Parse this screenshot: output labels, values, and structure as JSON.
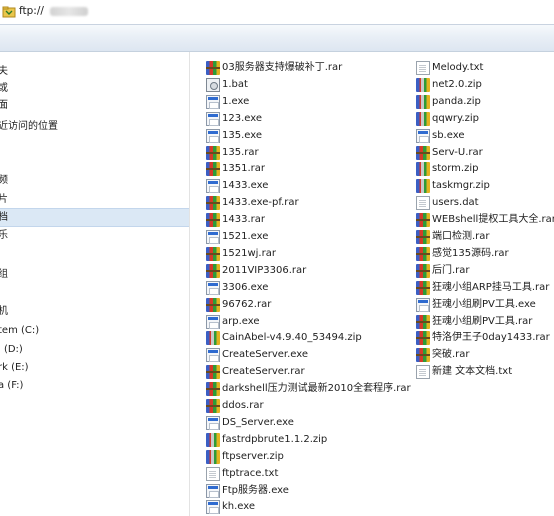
{
  "address": {
    "text": "ftp://"
  },
  "nav": {
    "items": [
      {
        "label": "夫"
      },
      {
        "label": "或"
      },
      {
        "label": "面"
      },
      {
        "label": "近访问的位置"
      },
      {
        "label": ""
      },
      {
        "label": ""
      },
      {
        "label": ""
      },
      {
        "label": "频"
      },
      {
        "label": "片"
      },
      {
        "label": "档"
      },
      {
        "label": "乐"
      },
      {
        "label": ""
      },
      {
        "label": ""
      },
      {
        "label": "组"
      },
      {
        "label": ""
      },
      {
        "label": ""
      },
      {
        "label": "机"
      },
      {
        "label": "tem (C:)"
      },
      {
        "label": "l (D:)"
      },
      {
        "label": "rk (E:)"
      },
      {
        "label": "a (F:)"
      }
    ]
  },
  "files": {
    "col1": [
      {
        "name": "03服务器支持爆破补丁.rar",
        "icon": "rar-icon"
      },
      {
        "name": "1.bat",
        "icon": "bat-icon"
      },
      {
        "name": "1.exe",
        "icon": "exe-icon"
      },
      {
        "name": "123.exe",
        "icon": "exe-icon"
      },
      {
        "name": "135.exe",
        "icon": "exe-icon"
      },
      {
        "name": "135.rar",
        "icon": "rar-icon"
      },
      {
        "name": "1351.rar",
        "icon": "rar-icon"
      },
      {
        "name": "1433.exe",
        "icon": "exe-icon"
      },
      {
        "name": "1433.exe-pf.rar",
        "icon": "rar-icon"
      },
      {
        "name": "1433.rar",
        "icon": "rar-icon"
      },
      {
        "name": "1521.exe",
        "icon": "exe-icon"
      },
      {
        "name": "1521wj.rar",
        "icon": "rar-icon"
      },
      {
        "name": "2011VIP3306.rar",
        "icon": "rar-icon"
      },
      {
        "name": "3306.exe",
        "icon": "exe-icon"
      },
      {
        "name": "96762.rar",
        "icon": "rar-icon"
      },
      {
        "name": "arp.exe",
        "icon": "exe-icon"
      },
      {
        "name": "CainAbel-v4.9.40_53494.zip",
        "icon": "zip-icon"
      },
      {
        "name": "CreateServer.exe",
        "icon": "exe-icon"
      },
      {
        "name": "CreateServer.rar",
        "icon": "rar-icon"
      },
      {
        "name": "darkshell压力测试最新2010全套程序.rar",
        "icon": "rar-icon"
      },
      {
        "name": "ddos.rar",
        "icon": "rar-icon"
      },
      {
        "name": "DS_Server.exe",
        "icon": "exe-icon"
      },
      {
        "name": "fastrdpbrute1.1.2.zip",
        "icon": "zip-icon"
      },
      {
        "name": "ftpserver.zip",
        "icon": "zip-icon"
      },
      {
        "name": "ftptrace.txt",
        "icon": "txt-icon"
      },
      {
        "name": "Ftp服务器.exe",
        "icon": "exe-icon"
      },
      {
        "name": "kh.exe",
        "icon": "exe-icon"
      }
    ],
    "col2": [
      {
        "name": "Melody.txt",
        "icon": "txt-icon"
      },
      {
        "name": "net2.0.zip",
        "icon": "zip-icon"
      },
      {
        "name": "panda.zip",
        "icon": "zip-icon"
      },
      {
        "name": "qqwry.zip",
        "icon": "zip-icon"
      },
      {
        "name": "sb.exe",
        "icon": "exe-icon"
      },
      {
        "name": "Serv-U.rar",
        "icon": "rar-icon"
      },
      {
        "name": "storm.zip",
        "icon": "zip-icon"
      },
      {
        "name": "taskmgr.zip",
        "icon": "zip-icon"
      },
      {
        "name": "users.dat",
        "icon": "txt-icon"
      },
      {
        "name": "WEBshell提权工具大全.rar",
        "icon": "rar-icon"
      },
      {
        "name": "端口检测.rar",
        "icon": "rar-icon"
      },
      {
        "name": "感觉135源码.rar",
        "icon": "rar-icon"
      },
      {
        "name": "后门.rar",
        "icon": "rar-icon"
      },
      {
        "name": "狂魂小组ARP挂马工具.rar",
        "icon": "rar-icon"
      },
      {
        "name": "狂魂小组刷PV工具.exe",
        "icon": "exe-icon"
      },
      {
        "name": "狂魂小组刷PV工具.rar",
        "icon": "rar-icon"
      },
      {
        "name": "特洛伊王子0day1433.rar",
        "icon": "rar-icon"
      },
      {
        "name": "突破.rar",
        "icon": "rar-icon"
      },
      {
        "name": "新建 文本文档.txt",
        "icon": "txt-icon"
      }
    ]
  }
}
